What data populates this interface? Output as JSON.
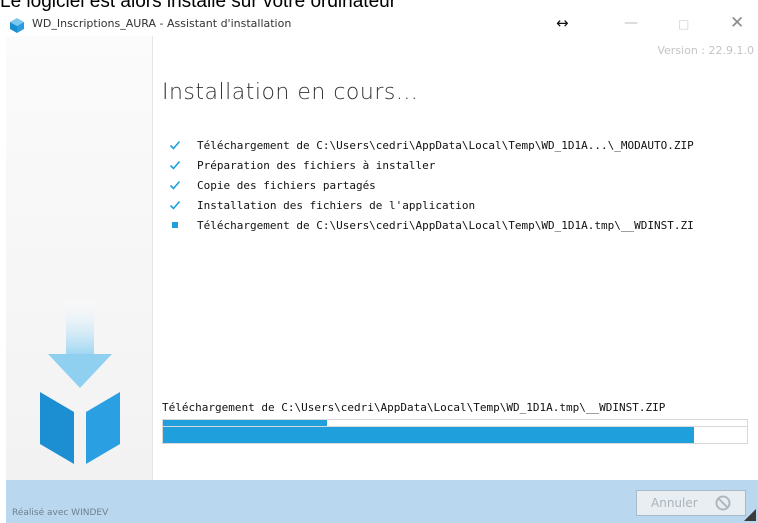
{
  "document_snippet": "Le logiciel est alors installé sur votre ordinateur",
  "window": {
    "title": "WD_Inscriptions_AURA - Assistant d'installation",
    "resize_icon": "↔",
    "minimize_icon": "—",
    "maximize_icon": "□",
    "close_icon": "✕"
  },
  "version": "Version : 22.9.1.0",
  "heading": "Installation en cours...",
  "steps": [
    {
      "status": "done",
      "label": "Téléchargement de C:\\Users\\cedri\\AppData\\Local\\Temp\\WD_1D1A...\\_MODAUTO.ZIP"
    },
    {
      "status": "done",
      "label": "Préparation des fichiers à installer"
    },
    {
      "status": "done",
      "label": "Copie des fichiers partagés"
    },
    {
      "status": "done",
      "label": "Installation des fichiers de l'application"
    },
    {
      "status": "in-progress",
      "label": "Téléchargement de C:\\Users\\cedri\\AppData\\Local\\Temp\\WD_1D1A.tmp\\__WDINST.ZI"
    }
  ],
  "progress": {
    "text": "Téléchargement de C:\\Users\\cedri\\AppData\\Local\\Temp\\WD_1D1A.tmp\\__WDINST.ZIP",
    "secondary_fraction": 0.28,
    "main_fraction": 0.91
  },
  "footer": {
    "credit": "Réalisé avec WINDEV",
    "cancel_label": "Annuler"
  },
  "colors": {
    "accent": "#1fa0dd",
    "footer_bg": "#b9d7ef",
    "check": "#1fa0dd"
  }
}
